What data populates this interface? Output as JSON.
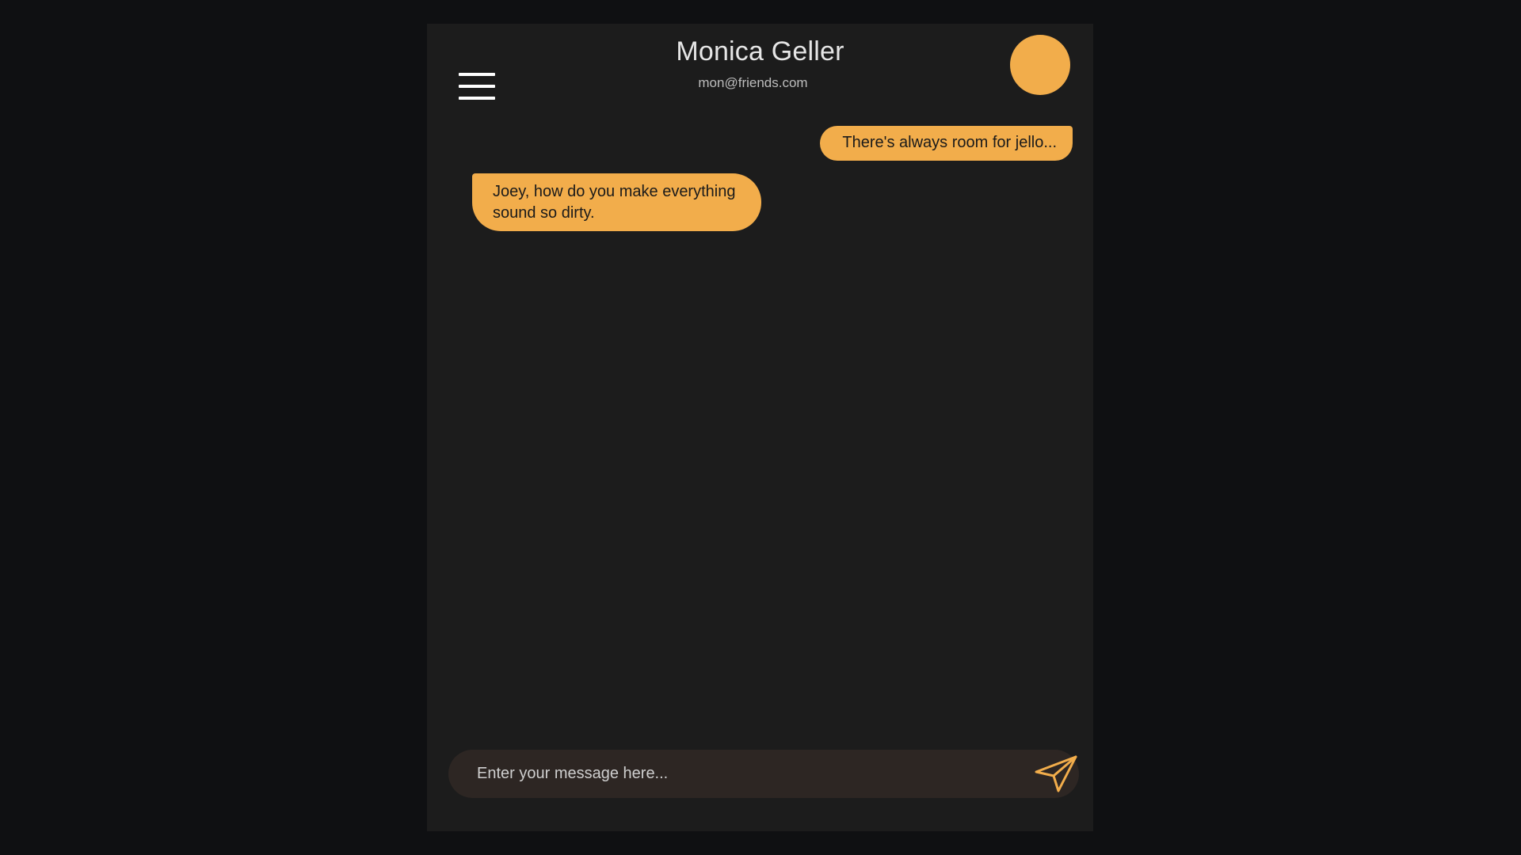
{
  "theme": {
    "accent": "#f2ad4b",
    "panel": "#1c1c1c",
    "background": "#0f1012",
    "composer": "#2d2623"
  },
  "header": {
    "menu_icon": "hamburger-menu-icon",
    "contact_name": "Monica Geller",
    "contact_email": "mon@friends.com",
    "avatar": "avatar"
  },
  "messages": [
    {
      "direction": "outgoing",
      "text": "There's always room for jello..."
    },
    {
      "direction": "incoming",
      "text": "Joey, how do you make everything sound so dirty."
    }
  ],
  "composer": {
    "placeholder": "Enter your message here...",
    "value": "",
    "send_icon": "paper-plane-icon"
  }
}
